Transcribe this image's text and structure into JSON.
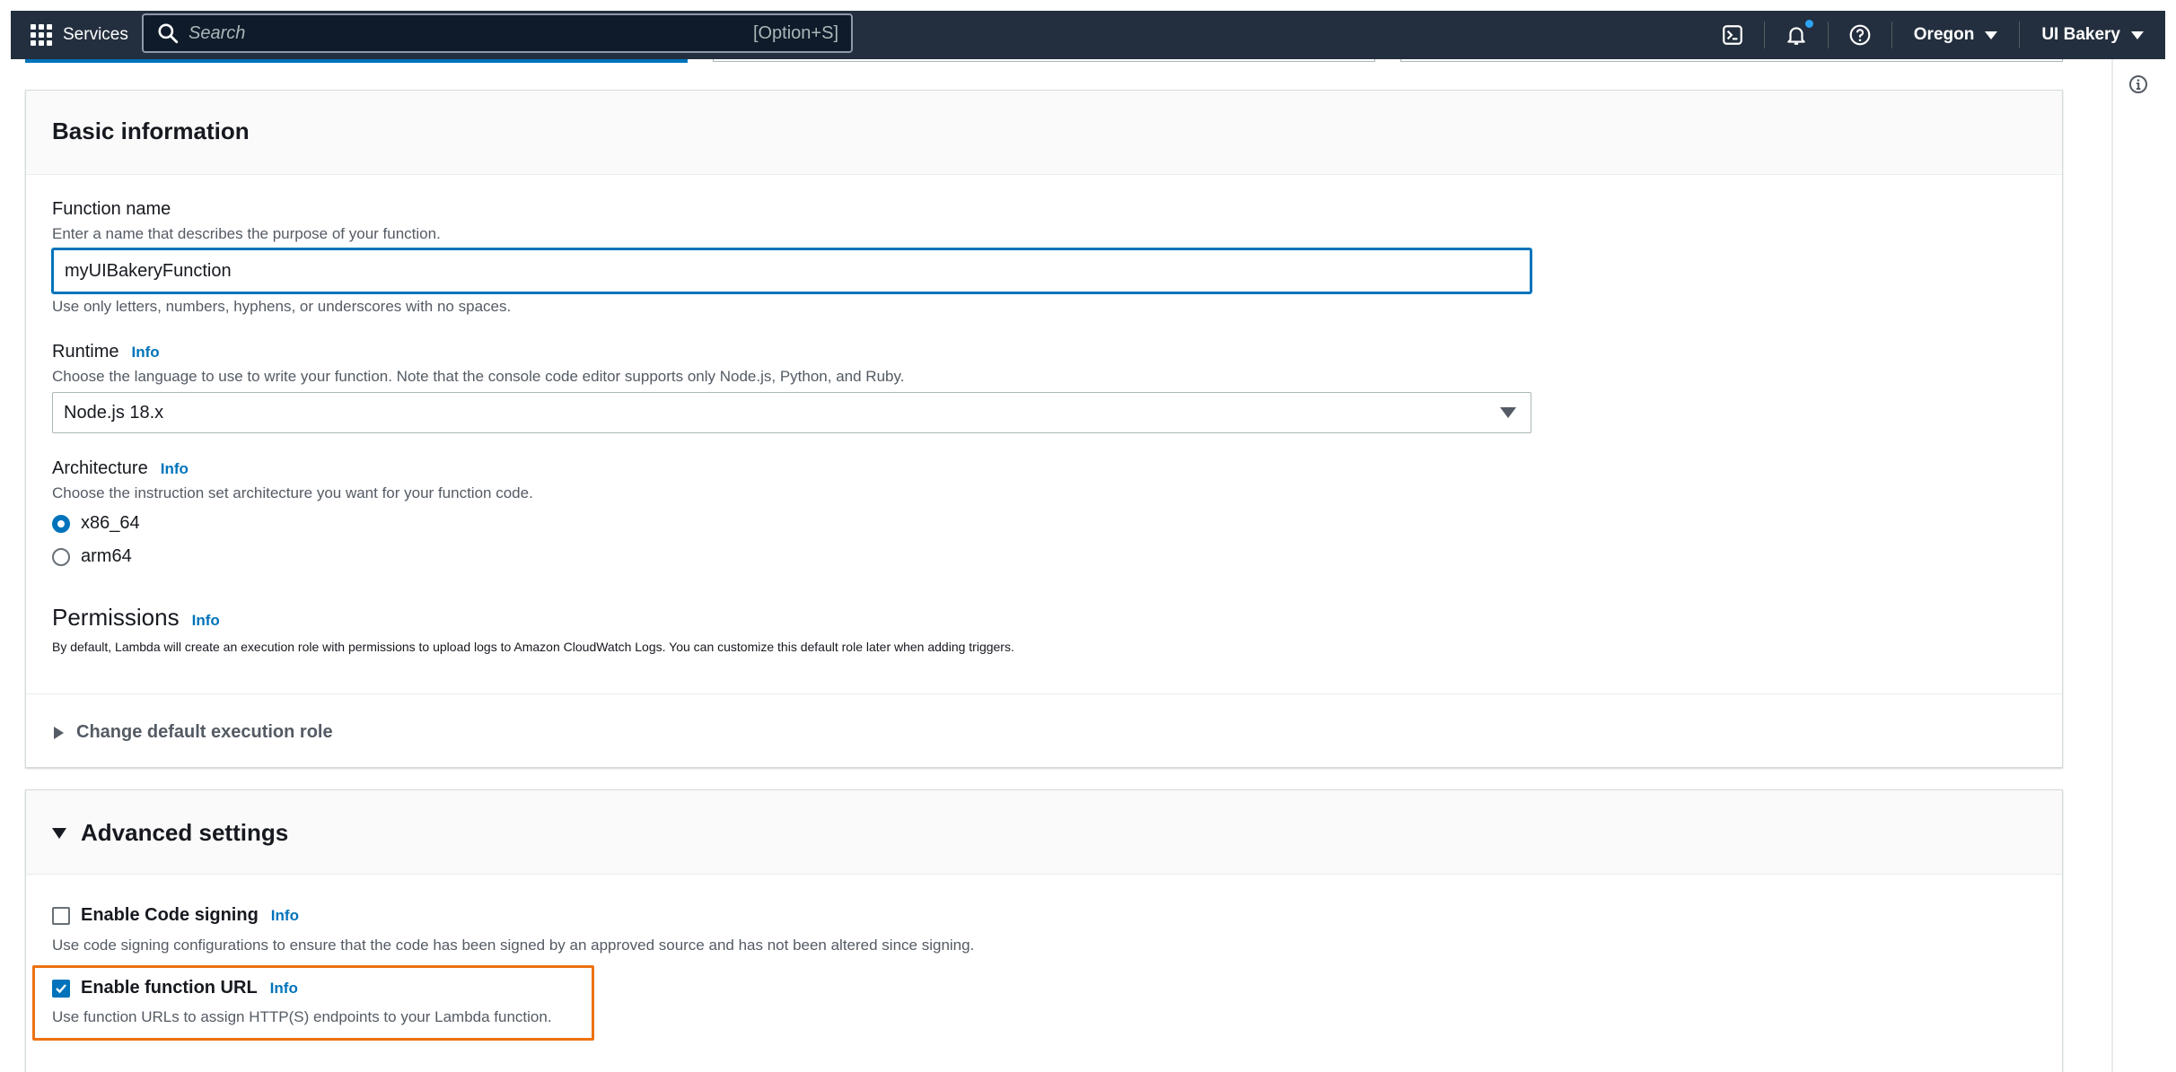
{
  "topnav": {
    "services_label": "Services",
    "search_placeholder": "Search",
    "search_shortcut": "[Option+S]",
    "region": "Oregon",
    "account": "UI Bakery"
  },
  "basic_info": {
    "title": "Basic information",
    "function_name": {
      "label": "Function name",
      "description": "Enter a name that describes the purpose of your function.",
      "value": "myUIBakeryFunction",
      "constraint": "Use only letters, numbers, hyphens, or underscores with no spaces."
    },
    "runtime": {
      "label": "Runtime",
      "info": "Info",
      "description": "Choose the language to use to write your function. Note that the console code editor supports only Node.js, Python, and Ruby.",
      "selected": "Node.js 18.x"
    },
    "architecture": {
      "label": "Architecture",
      "info": "Info",
      "description": "Choose the instruction set architecture you want for your function code.",
      "options": [
        "x86_64",
        "arm64"
      ],
      "selected": "x86_64"
    },
    "permissions": {
      "label": "Permissions",
      "info": "Info",
      "description": "By default, Lambda will create an execution role with permissions to upload logs to Amazon CloudWatch Logs. You can customize this default role later when adding triggers."
    },
    "change_role_label": "Change default execution role"
  },
  "advanced": {
    "title": "Advanced settings",
    "code_signing": {
      "label": "Enable Code signing",
      "info": "Info",
      "description": "Use code signing configurations to ensure that the code has been signed by an approved source and has not been altered since signing.",
      "checked": false
    },
    "function_url": {
      "label": "Enable function URL",
      "info": "Info",
      "description": "Use function URLs to assign HTTP(S) endpoints to your Lambda function.",
      "checked": true
    }
  },
  "colors": {
    "nav_bg": "#232f3e",
    "link": "#0073bb",
    "highlight": "#ec7211"
  },
  "icons": [
    "grid-icon",
    "search-icon",
    "cloudshell-icon",
    "bell-icon",
    "help-icon",
    "info-circle-icon",
    "caret-right-icon",
    "caret-down-icon",
    "checkmark-icon"
  ]
}
